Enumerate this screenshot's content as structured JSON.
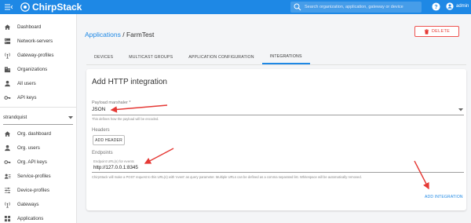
{
  "header": {
    "app_name": "ChirpStack",
    "search_placeholder": "Search organization, application, gateway or device",
    "user_name": "admin"
  },
  "sidebar": {
    "global_items": [
      {
        "label": "Dashboard",
        "icon": "home-icon"
      },
      {
        "label": "Network-servers",
        "icon": "server-icon"
      },
      {
        "label": "Gateway-profiles",
        "icon": "radio-tower-icon"
      },
      {
        "label": "Organizations",
        "icon": "domain-icon"
      },
      {
        "label": "All users",
        "icon": "person-icon"
      },
      {
        "label": "API keys",
        "icon": "key-icon"
      }
    ],
    "organization_selected": "strandquist",
    "org_items": [
      {
        "label": "Org. dashboard",
        "icon": "home-icon"
      },
      {
        "label": "Org. users",
        "icon": "person-icon"
      },
      {
        "label": "Org. API keys",
        "icon": "key-icon"
      },
      {
        "label": "Service-profiles",
        "icon": "account-details-icon"
      },
      {
        "label": "Device-profiles",
        "icon": "tune-icon"
      },
      {
        "label": "Gateways",
        "icon": "radio-tower-icon"
      },
      {
        "label": "Applications",
        "icon": "apps-icon"
      }
    ]
  },
  "breadcrumb": {
    "parent": "Applications",
    "separator": "/",
    "current": "FarmTest"
  },
  "delete_button": "DELETE",
  "tabs": [
    {
      "label": "DEVICES",
      "active": false
    },
    {
      "label": "MULTICAST GROUPS",
      "active": false
    },
    {
      "label": "APPLICATION CONFIGURATION",
      "active": false
    },
    {
      "label": "INTEGRATIONS",
      "active": true
    }
  ],
  "form": {
    "title": "Add HTTP integration",
    "payload_marshaler": {
      "label": "Payload marshaler *",
      "value": "JSON",
      "helper": "This defines how the payload will be encoded."
    },
    "headers": {
      "label": "Headers",
      "button": "ADD HEADER"
    },
    "endpoints": {
      "label": "Endpoints",
      "field_label": "Endpoint URL(s) for events",
      "value": "http://127.0.0.1:8345",
      "helper": "ChirpStack will make a POST request to this URL(s) with 'event' as query parameter. Multiple URLs can be defined as a comma separated list. Whitespace will be automatically removed."
    },
    "submit_button": "ADD INTEGRATION"
  },
  "colors": {
    "primary": "#1e88e5",
    "danger": "#e53935",
    "annotation_arrow": "#e53935"
  }
}
